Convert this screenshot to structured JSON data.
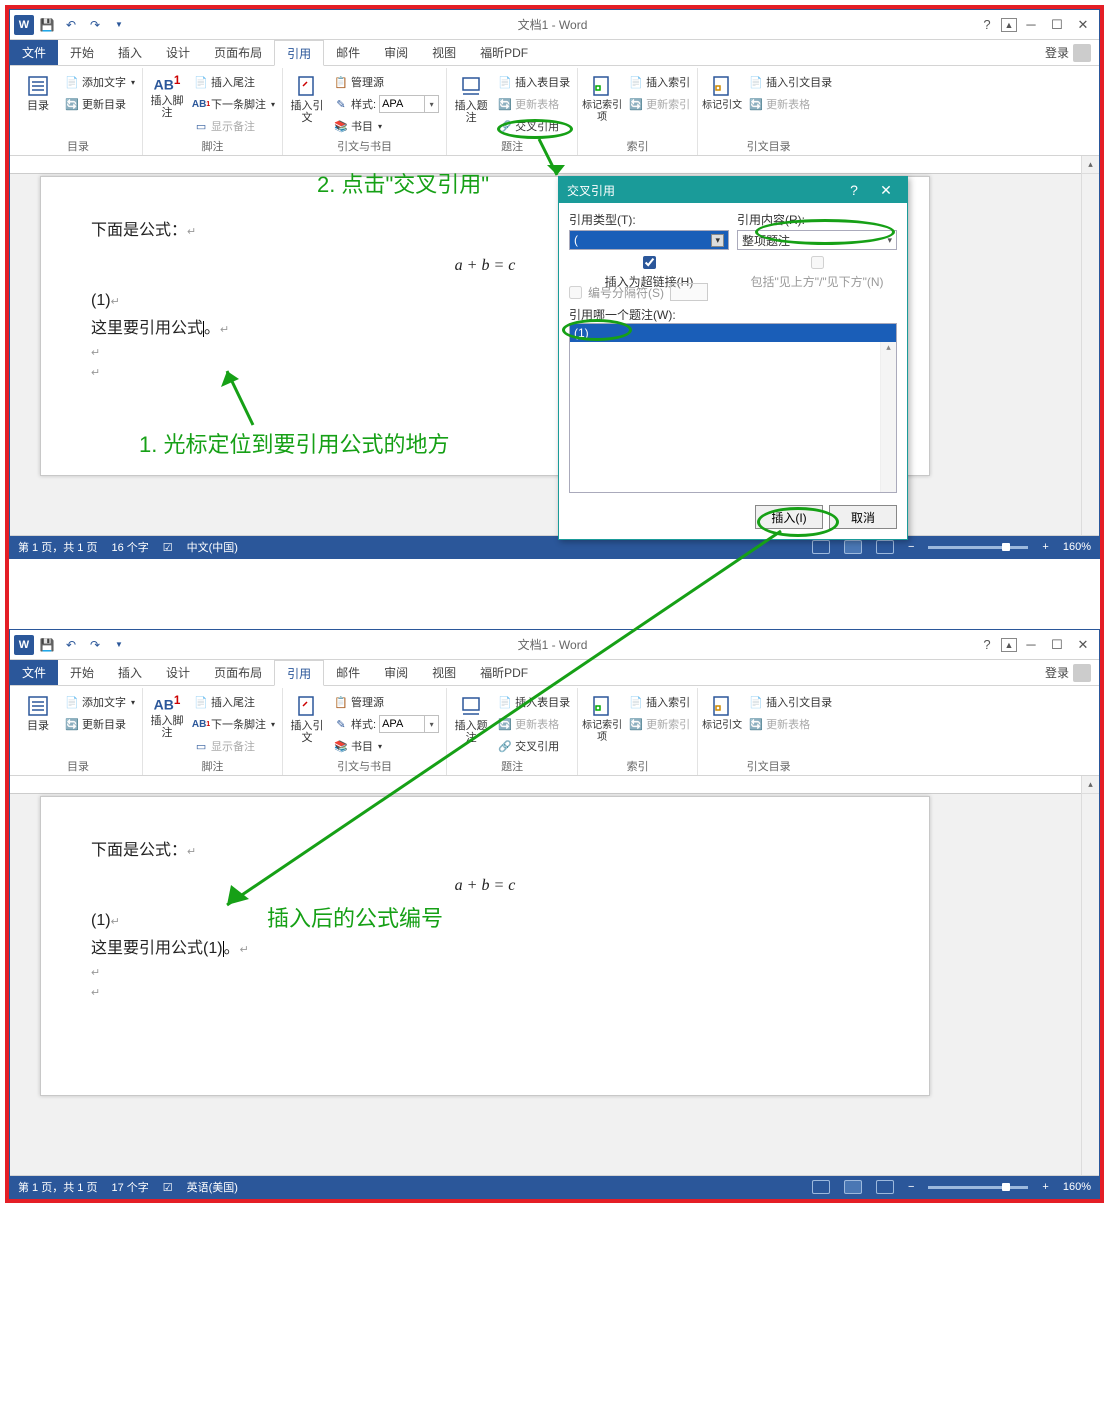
{
  "title": "文档1 - Word",
  "tabs": {
    "file": "文件",
    "home": "开始",
    "insert": "插入",
    "design": "设计",
    "layout": "页面布局",
    "references": "引用",
    "mailings": "邮件",
    "review": "审阅",
    "view": "视图",
    "foxit": "福昕PDF"
  },
  "login_text": "登录",
  "ribbon": {
    "toc": {
      "label": "目录",
      "btn": "目录",
      "add_text": "添加文字",
      "update": "更新目录"
    },
    "footnotes": {
      "label": "脚注",
      "btn": "插入脚注",
      "ab": "AB",
      "endnote": "插入尾注",
      "next": "下一条脚注",
      "show": "显示备注"
    },
    "citations": {
      "label": "引文与书目",
      "btn": "插入引文",
      "manage": "管理源",
      "style": "样式:",
      "style_val": "APA",
      "biblio": "书目"
    },
    "captions": {
      "label": "题注",
      "btn": "插入题注",
      "tof": "插入表目录",
      "update": "更新表格",
      "xref": "交叉引用"
    },
    "index": {
      "label": "索引",
      "btn": "标记索引项",
      "insert": "插入索引",
      "update": "更新索引"
    },
    "toa": {
      "label": "引文目录",
      "btn": "标记引文",
      "insert": "插入引文目录",
      "update": "更新表格"
    }
  },
  "doc1": {
    "line1": "下面是公式：",
    "eq": "a + b = c",
    "numline": "(1)",
    "line2": "这里要引用公式"
  },
  "doc2": {
    "line1": "下面是公式：",
    "eq": "a + b = c",
    "numline": "(1)",
    "line2_a": "这里要引用公式",
    "line2_b": "(1)"
  },
  "status1": {
    "page": "第 1 页，共 1 页",
    "wc": "16 个字",
    "lang": "中文(中国)",
    "zoom": "160%"
  },
  "status2": {
    "page": "第 1 页，共 1 页",
    "wc": "17 个字",
    "lang": "英语(美国)",
    "zoom": "160%"
  },
  "dialog": {
    "title": "交叉引用",
    "lbl_type": "引用类型(T):",
    "type_val": "(",
    "lbl_content": "引用内容(R):",
    "content_val": "整项题注",
    "chk_link": "插入为超链接(H)",
    "chk_above": "包括\"见上方\"/\"见下方\"(N)",
    "chk_sep": "编号分隔符(S)",
    "lbl_which": "引用哪一个题注(W):",
    "item0": "(1)",
    "btn_insert": "插入(I)",
    "btn_cancel": "取消"
  },
  "annotations": {
    "step1": "1. 光标定位到要引用公式的地方",
    "step2": "2. 点击\"交叉引用\"",
    "result": "插入后的公式编号"
  }
}
